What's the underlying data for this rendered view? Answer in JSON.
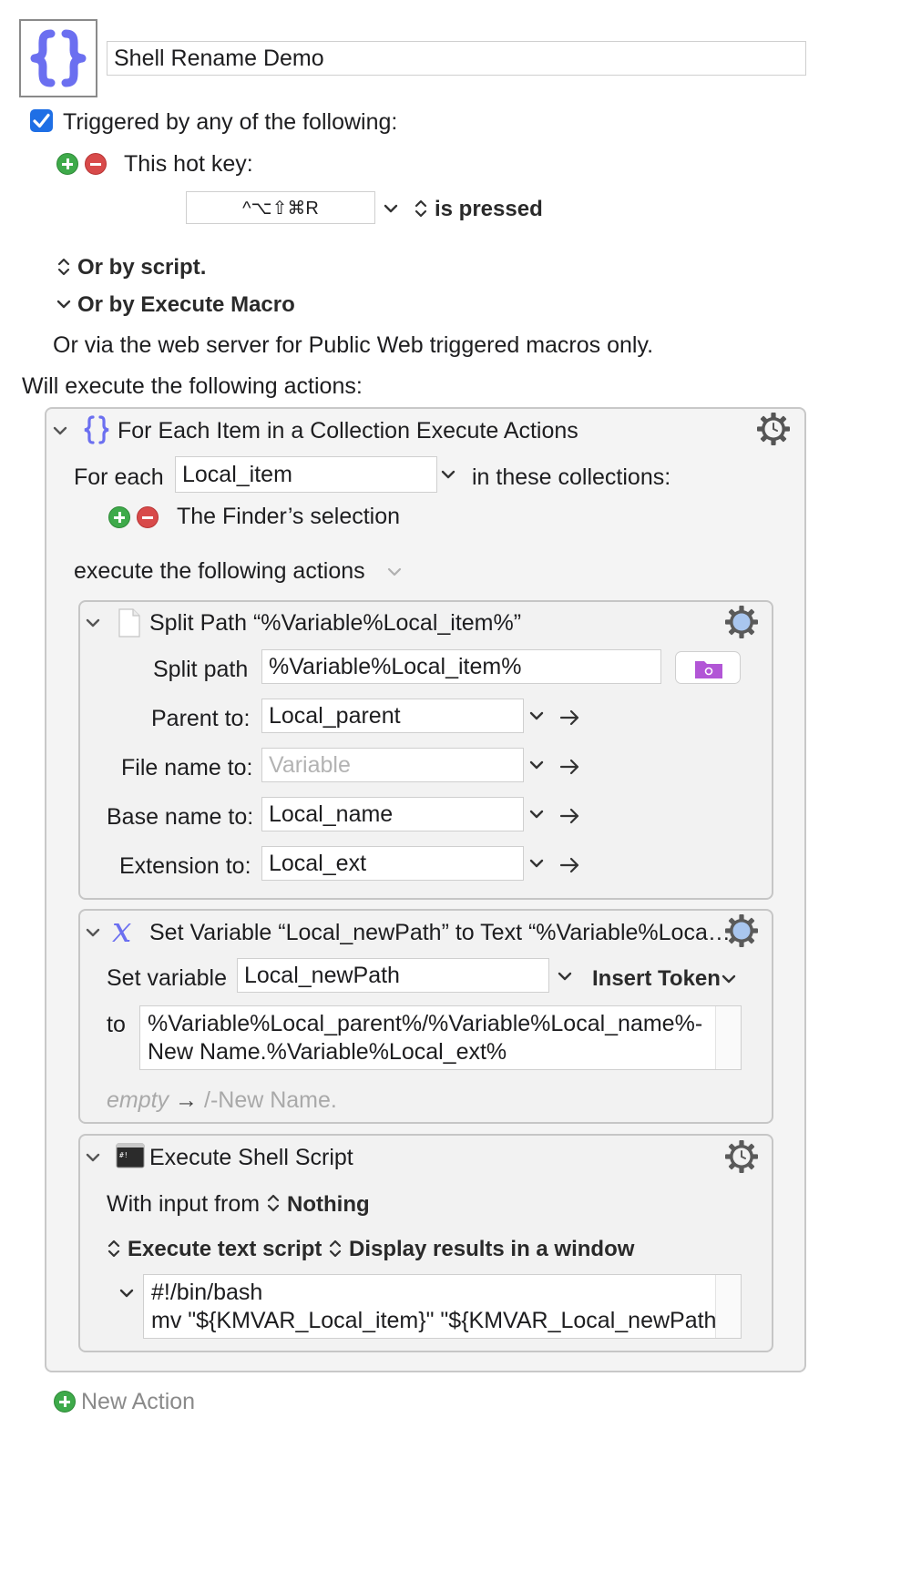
{
  "macro": {
    "title": "Shell Rename Demo",
    "triggered_label": "Triggered by any of the following:",
    "triggered_checked": true,
    "hotkey_label": "This hot key:",
    "hotkey_value": "^⌥⇧⌘R",
    "hotkey_state": "is pressed",
    "or_by_script": "Or by script.",
    "or_by_execute": "Or by Execute Macro",
    "web_server_note": "Or via the web server for Public Web triggered macros only.",
    "will_execute": "Will execute the following actions:"
  },
  "for_each": {
    "title": "For Each Item in a Collection Execute Actions",
    "for_each_label": "For each",
    "variable": "Local_item",
    "in_collections": "in these collections:",
    "collection_item": "The Finder’s selection",
    "execute_label": "execute the following actions"
  },
  "split_path": {
    "title": "Split Path “%Variable%Local_item%”",
    "split_label": "Split path",
    "split_value": "%Variable%Local_item%",
    "parent_label": "Parent to:",
    "parent_value": "Local_parent",
    "filename_label": "File name to:",
    "filename_placeholder": "Variable",
    "basename_label": "Base name to:",
    "basename_value": "Local_name",
    "extension_label": "Extension to:",
    "extension_value": "Local_ext"
  },
  "set_variable": {
    "title": "Set Variable “Local_newPath” to Text “%Variable%Loca…",
    "set_label": "Set variable",
    "variable_value": "Local_newPath",
    "insert_token": "Insert Token",
    "to_label": "to",
    "text_line1": "%Variable%Local_parent%/%Variable%Local_name%-",
    "text_line2": "New Name.%Variable%Local_ext%",
    "preview_empty": "empty",
    "preview_result": "/-New Name."
  },
  "shell_script": {
    "title": "Execute Shell Script",
    "input_label": "With input from",
    "input_value": "Nothing",
    "execute_mode": "Execute text script",
    "display_mode": "Display results in a window",
    "script_line1": "#!/bin/bash",
    "script_line2": "mv \"${KMVAR_Local_item}\" \"${KMVAR_Local_newPath}\""
  },
  "footer": {
    "new_action": "New Action"
  },
  "colors": {
    "accent": "#1f6fe5",
    "macro_icon": "#6b6ff0",
    "plus": "#3eaa4a",
    "minus": "#d84a4a",
    "gear": "#5a5a5a"
  }
}
